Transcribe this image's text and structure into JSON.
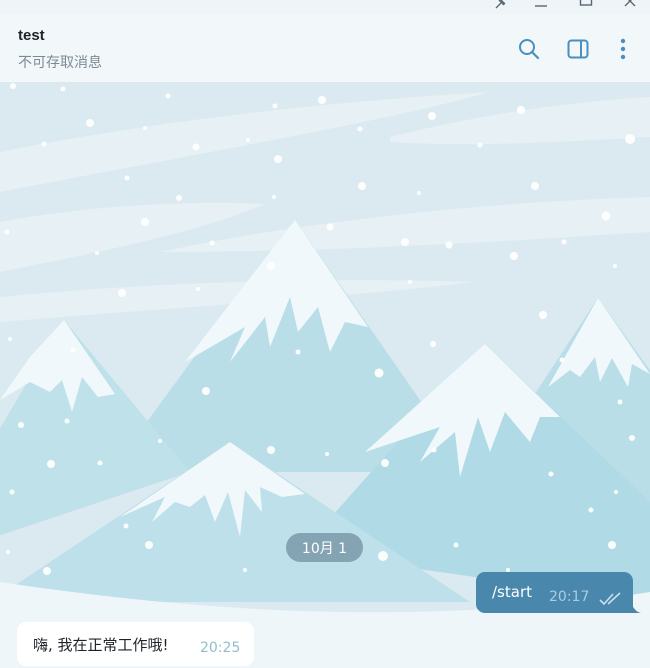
{
  "window": {
    "controls": [
      "pin-icon",
      "minimize-icon",
      "maximize-icon",
      "close-icon"
    ]
  },
  "header": {
    "title": "test",
    "subtitle": "不可存取消息",
    "actions": [
      "search-icon",
      "sidebar-toggle-icon",
      "more-vertical-icon"
    ]
  },
  "chat": {
    "date_separator": "10月 1",
    "messages": [
      {
        "direction": "out",
        "text": "/start",
        "time": "20:17",
        "status": "read"
      },
      {
        "direction": "in",
        "text": "嗨, 我在正常工作哦!",
        "time": "20:25"
      }
    ]
  },
  "colors": {
    "accent": "#4a87ad",
    "header_bg": "#f2f7fa",
    "wallpaper_sky": "#dbeaf1",
    "mountain": "#b5dde8",
    "snow": "#f1f8fb"
  }
}
